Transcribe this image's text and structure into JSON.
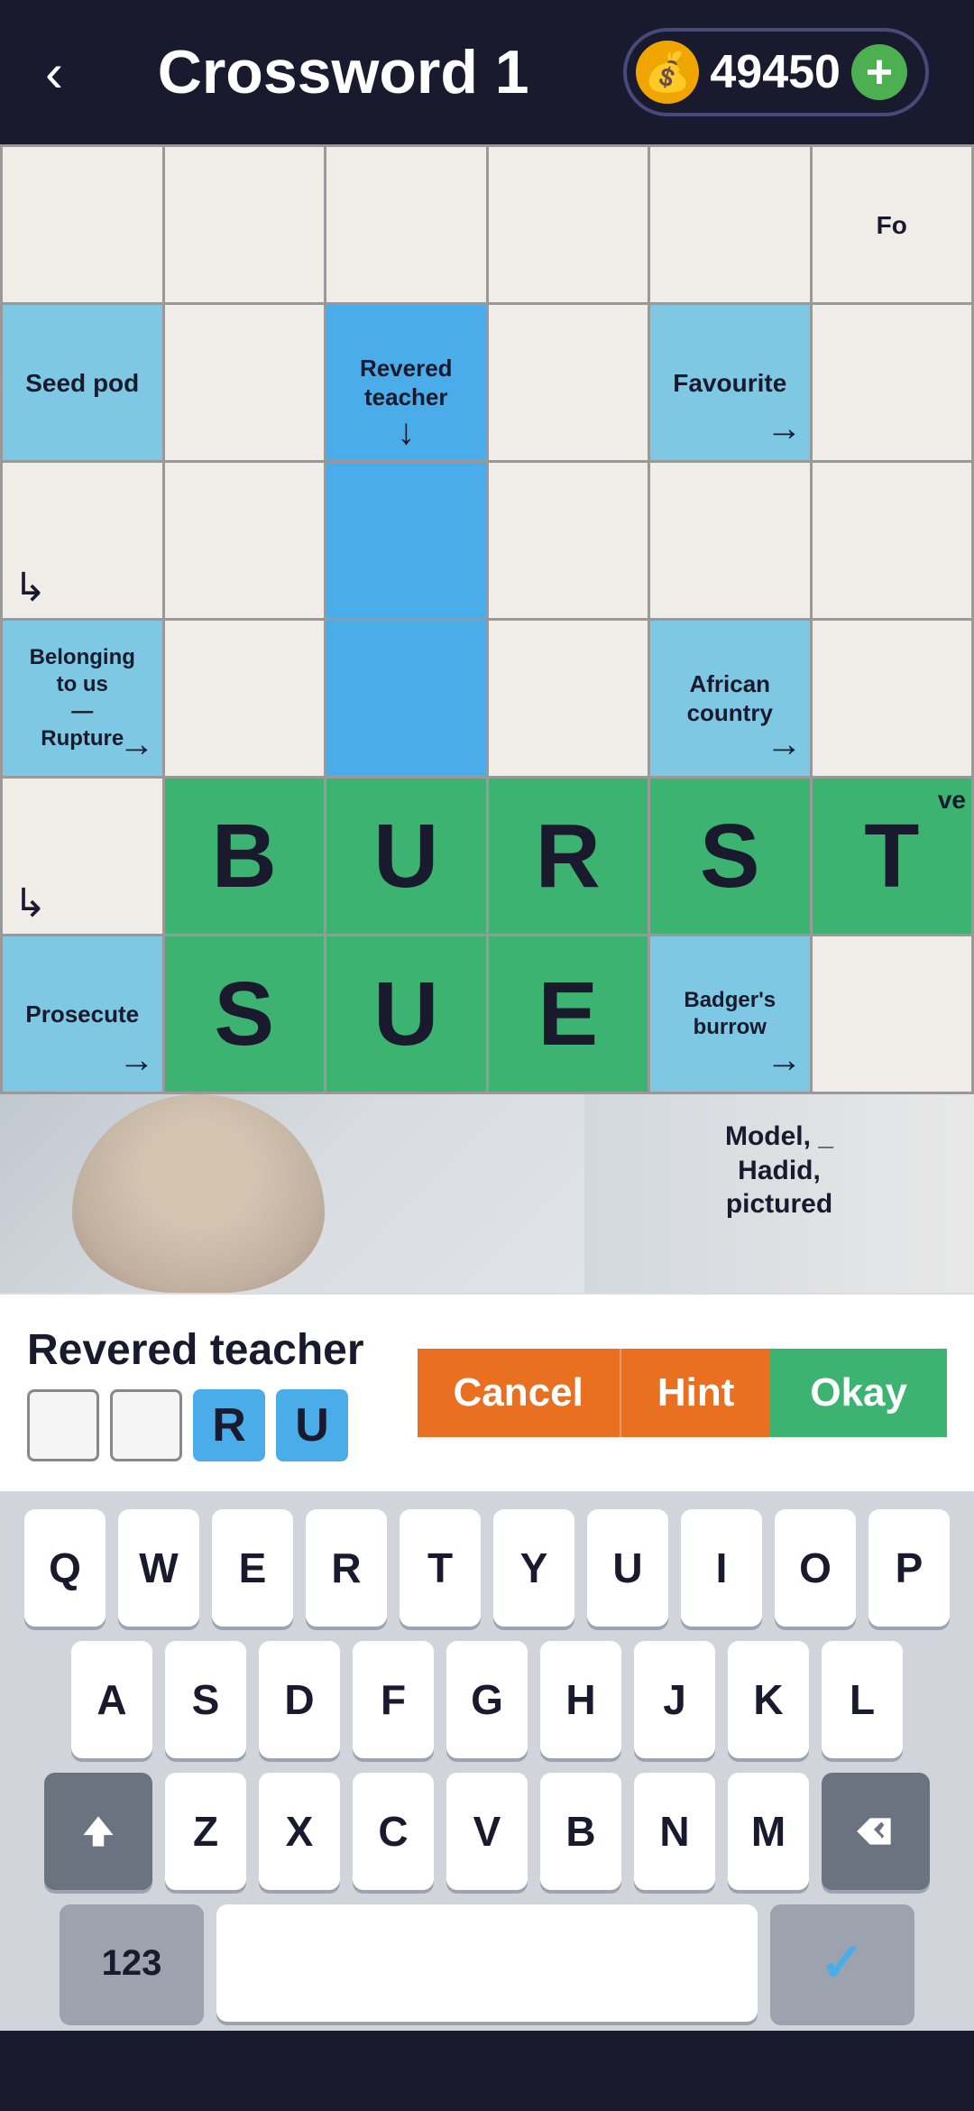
{
  "header": {
    "back_label": "‹",
    "title": "Crossword 1",
    "coin_icon": "💰",
    "coin_value": "49450",
    "plus_label": "+"
  },
  "grid": {
    "rows": [
      [
        {
          "type": "white",
          "content": ""
        },
        {
          "type": "white",
          "content": ""
        },
        {
          "type": "white",
          "content": ""
        },
        {
          "type": "white",
          "content": ""
        },
        {
          "type": "white",
          "content": ""
        },
        {
          "type": "white",
          "clue": "Fo",
          "partial": true
        }
      ],
      [
        {
          "type": "blue_light",
          "clue": "Seed pod",
          "arrow": "none"
        },
        {
          "type": "white",
          "content": ""
        },
        {
          "type": "blue_medium",
          "clue": "Revered\nteacher",
          "arrow": "down"
        },
        {
          "type": "white",
          "content": ""
        },
        {
          "type": "blue_light",
          "clue": "Favourite",
          "arrow": "right"
        },
        {
          "type": "white",
          "content": ""
        }
      ],
      [
        {
          "type": "white",
          "corner": true
        },
        {
          "type": "white",
          "content": ""
        },
        {
          "type": "blue_medium",
          "content": ""
        },
        {
          "type": "white",
          "content": ""
        },
        {
          "type": "white",
          "content": ""
        },
        {
          "type": "white",
          "content": ""
        }
      ],
      [
        {
          "type": "blue_light",
          "clue": "Belonging\nto us\n—\nRupture",
          "arrow": "right"
        },
        {
          "type": "white",
          "content": ""
        },
        {
          "type": "blue_medium",
          "content": ""
        },
        {
          "type": "white",
          "content": ""
        },
        {
          "type": "blue_light",
          "clue": "African\ncountry",
          "arrow": "right"
        },
        {
          "type": "white",
          "content": ""
        }
      ],
      [
        {
          "type": "white",
          "corner2": true
        },
        {
          "type": "green",
          "letter": "B"
        },
        {
          "type": "green",
          "letter": "U"
        },
        {
          "type": "green",
          "letter": "R"
        },
        {
          "type": "green",
          "letter": "S"
        },
        {
          "type": "green",
          "letter": "T",
          "partial_right": "ve"
        }
      ],
      [
        {
          "type": "blue_light",
          "clue": "Prosecute",
          "arrow": "right"
        },
        {
          "type": "green",
          "letter": "S"
        },
        {
          "type": "green",
          "letter": "U"
        },
        {
          "type": "green",
          "letter": "E"
        },
        {
          "type": "blue_light",
          "clue": "Badger's\nburrow",
          "arrow": "right"
        },
        {
          "type": "white",
          "content": ""
        }
      ]
    ]
  },
  "photo_row": {
    "right_clue": "Model, _\nHadid,\npictured"
  },
  "clue_bar": {
    "clue_text": "Revered teacher",
    "answer_boxes": [
      {
        "filled": false,
        "letter": ""
      },
      {
        "filled": false,
        "letter": ""
      },
      {
        "filled": true,
        "letter": "R"
      },
      {
        "filled": true,
        "letter": "U"
      }
    ],
    "cancel_label": "Cancel",
    "hint_label": "Hint",
    "okay_label": "Okay"
  },
  "keyboard": {
    "row1": [
      "Q",
      "W",
      "E",
      "R",
      "T",
      "Y",
      "U",
      "I",
      "O",
      "P"
    ],
    "row2": [
      "A",
      "S",
      "D",
      "F",
      "G",
      "H",
      "J",
      "K",
      "L"
    ],
    "row3_shift": "⇧",
    "row3": [
      "Z",
      "X",
      "C",
      "V",
      "B",
      "N",
      "M"
    ],
    "row3_back": "⌫",
    "row4_123": "123",
    "row4_space": "",
    "row4_check": "✓"
  }
}
